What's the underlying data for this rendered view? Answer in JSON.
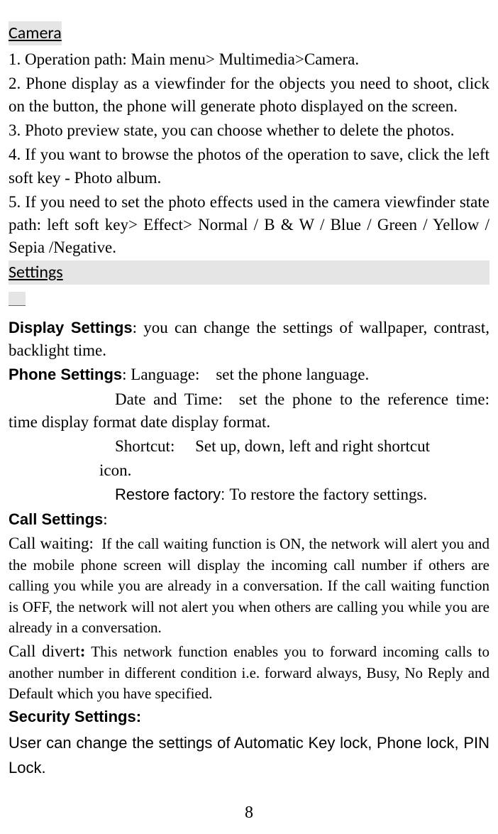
{
  "camera": {
    "title": "Camera",
    "p1": "1. Operation path: Main menu> Multimedia>Camera.",
    "p2": "2. Phone display as a viewfinder for the objects you need to shoot, click on the button, the phone will generate photo displayed on the screen.",
    "p3": "3. Photo preview state, you can choose whether to delete the photos.",
    "p4": "4. If you want to browse the photos of the operation to save, click the left soft key - Photo album.",
    "p5": "5. If you need to set the photo effects used in the camera viewfinder state path: left soft key> Effect> Normal / B & W / Blue / Green / Yellow / Sepia /Negative."
  },
  "settings": {
    "title": "Settings",
    "display_label": "Display Settings",
    "display_text": ": you can change the settings of wallpaper, contrast, backlight time.",
    "phone_label": "Phone Settings",
    "phone_lang": ": Language: set the phone language.",
    "phone_date": "Date and Time: set the phone to the reference time: time display format date display format.",
    "phone_shortcut_a": "Shortcut:  Set up, down, left and right shortcut",
    "phone_shortcut_b": "icon.",
    "phone_restore_a": "Restore factory: ",
    "phone_restore_b": "To restore the factory settings.",
    "call_label": "Call Settings",
    "call_colon": ":",
    "call_waiting_label": "Call waiting:",
    "call_waiting_text": "If the call waiting function is ON, the network will alert you and the mobile phone screen will display the incoming call number if others are calling you while you are already in a conversation. If the call waiting function is OFF, the network will not alert you when others are calling you while you are already in a conversation.",
    "call_divert_label": "Call divert",
    "call_divert_text": " This network function enables you to forward incoming calls to another number in different condition i.e. forward always, Busy, No Reply and Default which you have specified.",
    "security_label": "Security Settings:",
    "security_text": "User can change the settings of Automatic Key lock, Phone lock, PIN Lock."
  },
  "page_number": "8"
}
